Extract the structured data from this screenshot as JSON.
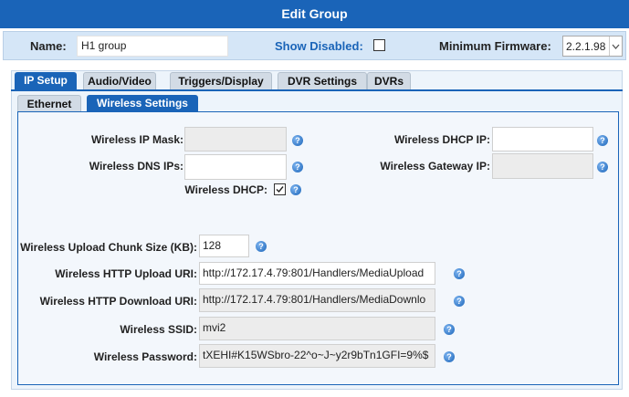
{
  "title": "Edit Group",
  "header": {
    "name_label": "Name:",
    "name_value": "H1 group",
    "show_disabled_label": "Show Disabled:",
    "show_disabled_checked": false,
    "min_firmware_label": "Minimum Firmware:",
    "min_firmware_value": "2.2.1.98"
  },
  "tabs": [
    {
      "label": "IP Setup",
      "active": true
    },
    {
      "label": "Audio/Video",
      "active": false
    },
    {
      "label": "Triggers/Display",
      "active": false
    },
    {
      "label": "DVR Settings",
      "active": false
    },
    {
      "label": "DVRs",
      "active": false
    }
  ],
  "subtabs": [
    {
      "label": "Ethernet",
      "active": false
    },
    {
      "label": "Wireless Settings",
      "active": true
    }
  ],
  "wireless": {
    "ip_mask_label": "Wireless IP Mask:",
    "ip_mask_value": "",
    "dhcp_ip_label": "Wireless DHCP IP:",
    "dhcp_ip_value": "",
    "dns_ips_label": "Wireless DNS IPs:",
    "dns_ips_value": "",
    "gateway_ip_label": "Wireless Gateway IP:",
    "gateway_ip_value": "",
    "dhcp_label": "Wireless DHCP:",
    "dhcp_checked": true,
    "chunk_size_label": "Wireless Upload Chunk Size (KB):",
    "chunk_size_value": "128",
    "http_upload_label": "Wireless HTTP Upload URI:",
    "http_upload_value": "http://172.17.4.79:801/Handlers/MediaUpload",
    "http_download_label": "Wireless HTTP Download URI:",
    "http_download_value": "http://172.17.4.79:801/Handlers/MediaDownlo",
    "ssid_label": "Wireless SSID:",
    "ssid_value": "mvi2",
    "password_label": "Wireless Password:",
    "password_value": "tXEHI#K15WSbro-22^o~J~y2r9bTn1GFI=9%$"
  },
  "icons": {
    "help": "question-help-icon",
    "dropdown": "chevron-down-icon",
    "check": "checkmark-icon"
  },
  "colors": {
    "accent": "#1a64b8",
    "header_bg": "#d5e6f7",
    "panel_bg": "#f3f7fc"
  }
}
